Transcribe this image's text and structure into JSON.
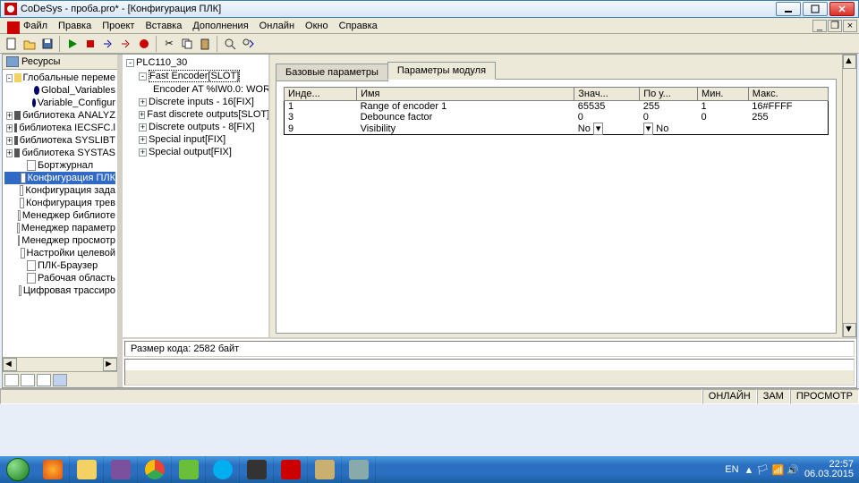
{
  "window": {
    "title": "CoDeSys - проба.pro* - [Конфигурация ПЛК]"
  },
  "menu": [
    "Файл",
    "Правка",
    "Проект",
    "Вставка",
    "Дополнения",
    "Онлайн",
    "Окно",
    "Справка"
  ],
  "leftpane": {
    "title": "Ресурсы",
    "items": [
      {
        "ex": "-",
        "ic": "folder",
        "txt": "Глобальные переме",
        "sel": false,
        "ind": 0
      },
      {
        "ex": "",
        "ic": "dot",
        "txt": "Global_Variables",
        "sel": false,
        "ind": 2
      },
      {
        "ex": "",
        "ic": "dot",
        "txt": "Variable_Configur",
        "sel": false,
        "ind": 2
      },
      {
        "ex": "+",
        "ic": "book",
        "txt": "библиотека ANALYZ",
        "sel": false,
        "ind": 0
      },
      {
        "ex": "+",
        "ic": "book",
        "txt": "библиотека IECSFC.l",
        "sel": false,
        "ind": 0
      },
      {
        "ex": "+",
        "ic": "book",
        "txt": "библиотека SYSLIBT",
        "sel": false,
        "ind": 0
      },
      {
        "ex": "+",
        "ic": "book",
        "txt": "библиотека SYSTAS",
        "sel": false,
        "ind": 0
      },
      {
        "ex": "",
        "ic": "doc",
        "txt": "Бортжурнал",
        "sel": false,
        "ind": 1
      },
      {
        "ex": "",
        "ic": "doc",
        "txt": "Конфигурация ПЛК",
        "sel": true,
        "ind": 1
      },
      {
        "ex": "",
        "ic": "doc",
        "txt": "Конфигурация зада",
        "sel": false,
        "ind": 1
      },
      {
        "ex": "",
        "ic": "doc",
        "txt": "Конфигурация трев",
        "sel": false,
        "ind": 1
      },
      {
        "ex": "",
        "ic": "doc",
        "txt": "Менеджер библиоте",
        "sel": false,
        "ind": 1
      },
      {
        "ex": "",
        "ic": "doc",
        "txt": "Менеджер параметр",
        "sel": false,
        "ind": 1
      },
      {
        "ex": "",
        "ic": "doc",
        "txt": "Менеджер просмотр",
        "sel": false,
        "ind": 1
      },
      {
        "ex": "",
        "ic": "doc",
        "txt": "Настройки целевой",
        "sel": false,
        "ind": 1
      },
      {
        "ex": "",
        "ic": "doc",
        "txt": "ПЛК-Браузер",
        "sel": false,
        "ind": 1
      },
      {
        "ex": "",
        "ic": "doc",
        "txt": "Рабочая область",
        "sel": false,
        "ind": 1
      },
      {
        "ex": "",
        "ic": "doc",
        "txt": "Цифровая трассиро",
        "sel": false,
        "ind": 1
      }
    ]
  },
  "devtree": [
    {
      "ex": "-",
      "txt": "PLC110_30",
      "ind": 0,
      "sel": false
    },
    {
      "ex": "-",
      "txt": "Fast Encoder[SLOT]",
      "ind": 1,
      "sel": true
    },
    {
      "ex": "",
      "txt": "Encoder AT %IW0.0: WOR",
      "ind": 2,
      "sel": false
    },
    {
      "ex": "+",
      "txt": "Discrete inputs - 16[FIX]",
      "ind": 1,
      "sel": false
    },
    {
      "ex": "+",
      "txt": "Fast discrete outputs[SLOT]",
      "ind": 1,
      "sel": false
    },
    {
      "ex": "+",
      "txt": "Discrete outputs - 8[FIX]",
      "ind": 1,
      "sel": false
    },
    {
      "ex": "+",
      "txt": "Special input[FIX]",
      "ind": 1,
      "sel": false
    },
    {
      "ex": "+",
      "txt": "Special output[FIX]",
      "ind": 1,
      "sel": false
    }
  ],
  "tabs": {
    "t1": "Базовые параметры",
    "t2": "Параметры модуля"
  },
  "paramTable": {
    "headers": [
      "Инде...",
      "Имя",
      "Знач...",
      "По у...",
      "Мин.",
      "Макс."
    ],
    "rows": [
      {
        "idx": "1",
        "name": "Range of encoder 1",
        "val": "65535",
        "def": "255",
        "min": "1",
        "max": "16#FFFF"
      },
      {
        "idx": "3",
        "name": "Debounce factor",
        "val": "0",
        "def": "0",
        "min": "0",
        "max": "255"
      },
      {
        "idx": "9",
        "name": "Visibility",
        "val": "No",
        "def": "No",
        "min": "",
        "max": ""
      }
    ]
  },
  "lower": {
    "msg": "Размер кода: 2582 байт"
  },
  "status": {
    "s1": "ОНЛАЙН",
    "s2": "ЗАМ",
    "s3": "ПРОСМОТР"
  },
  "tray": {
    "lang": "EN",
    "time": "22:57",
    "date": "06.03.2015"
  }
}
